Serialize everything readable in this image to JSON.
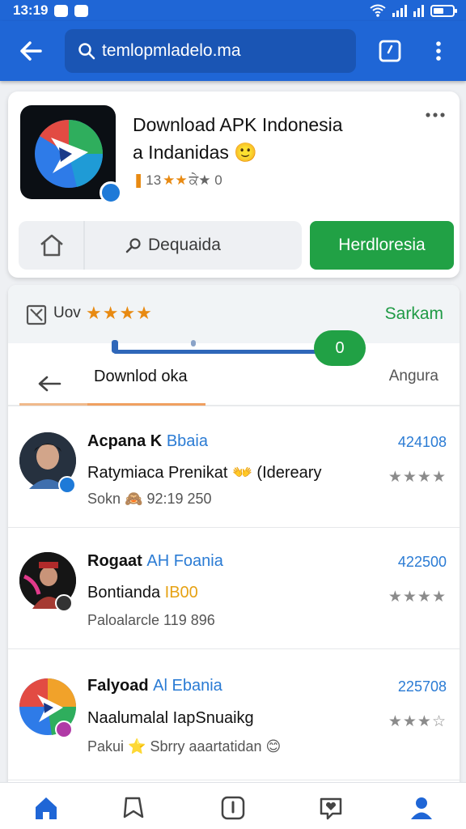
{
  "status": {
    "time": "13:19"
  },
  "browser": {
    "url": "temlopmladelo.ma"
  },
  "app": {
    "title_line1": "Download APK Indonesia",
    "title_line2": "a Indanidas",
    "title_emoji": "🙂",
    "rating_prefix": "13",
    "rating_suffix": "ਕੇ★ 0",
    "home_action": "Dequaida",
    "primary_action": "Herdloresia",
    "colors": {
      "primary": "#1f66d6",
      "green": "#21a145"
    }
  },
  "banner": {
    "label": "Uov",
    "stars": "★★★★",
    "action": "Sarkam",
    "slider_value": "0"
  },
  "tabs": {
    "active": "Downlod oka",
    "other": "Angura"
  },
  "items": [
    {
      "name": "Acpana K",
      "tag": "Bbaia",
      "subtitle": "Ratymiaca Prenikat",
      "subtitle_hl": "👐 (Idereary",
      "meta": "Sokn 🙈 92:19 250",
      "number": "424108",
      "stars": "★★★★"
    },
    {
      "name": "Rogaat",
      "tag": "AH Foania",
      "subtitle": "Bontianda",
      "subtitle_hl": "IB00",
      "meta": "Paloalarcle 119 896",
      "number": "422500",
      "stars": "★★★★"
    },
    {
      "name": "Falyoad",
      "tag": "Al Ebania",
      "subtitle": "Naalumalal IapSnuaikg",
      "subtitle_hl": "",
      "meta": "Pakui ⭐ Sbrry aaartatidan 😊",
      "number": "225708",
      "stars": "★★★☆"
    }
  ],
  "icons": [
    "back-arrow-icon",
    "search-icon",
    "tabs-icon",
    "more-vert-icon",
    "more-horiz-icon",
    "home-icon",
    "search-small-icon",
    "image-off-icon",
    "bookmark-icon",
    "info-icon",
    "heart-chat-icon",
    "profile-icon"
  ]
}
